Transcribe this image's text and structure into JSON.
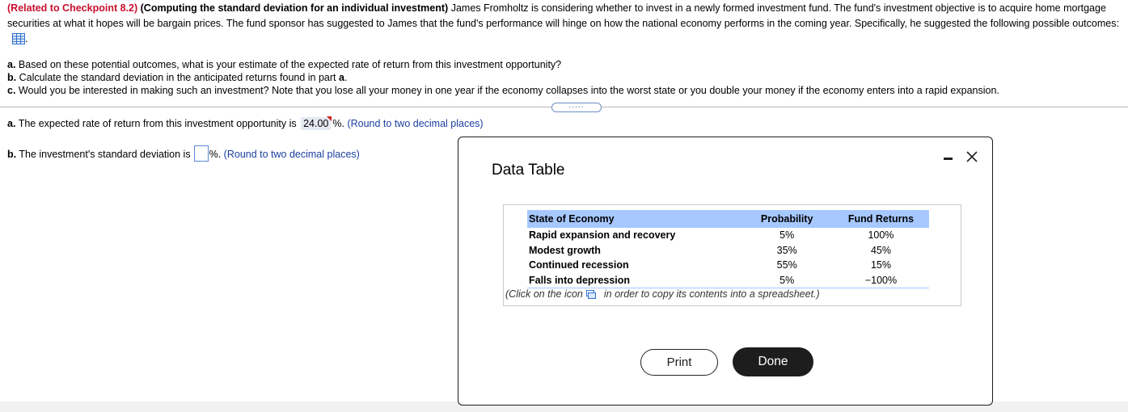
{
  "problem": {
    "tag": "(Related to Checkpoint 8.2)",
    "heading": "(Computing the standard deviation for an individual investment)",
    "body": "James Fromholtz is considering whether to invest in a newly formed investment fund. The fund's investment objective is to acquire home mortgage securities at what it hopes will be bargain prices. The fund sponsor has suggested to James that the fund's performance will hinge on how the national economy performs in the coming year. Specifically, he suggested the following possible outcomes:",
    "icon": "table-grid-icon",
    "after_icon": "."
  },
  "questions": {
    "a_letter": "a.",
    "a_text": "Based on these potential outcomes, what is your estimate of the expected rate of return from this investment opportunity?",
    "b_letter": "b.",
    "b_text": "Calculate the standard deviation in the anticipated returns found in part",
    "b_ref": "a",
    "b_end": ".",
    "c_letter": "c.",
    "c_text": "Would you be interested in making such an investment? Note that you lose all your money in one year if the economy collapses into the worst state or you double your money if the economy enters into a rapid expansion."
  },
  "more_dots": ".....",
  "answers": {
    "a_letter": "a.",
    "a_text": "The expected rate of return from this investment opportunity is",
    "a_value": "24.00",
    "a_unit": "%.",
    "a_hint": "(Round to two decimal places)",
    "b_letter": "b.",
    "b_text": "The investment's standard deviation is",
    "b_value": "",
    "b_unit": "%.",
    "b_hint": "(Round to two decimal places)"
  },
  "dialog": {
    "title": "Data Table",
    "columns": [
      "State of Economy",
      "Probability",
      "Fund Returns"
    ],
    "rows": [
      [
        "Rapid expansion and recovery",
        "5%",
        "100%"
      ],
      [
        "Modest growth",
        "35%",
        "45%"
      ],
      [
        "Continued recession",
        "55%",
        "15%"
      ],
      [
        "Falls into depression",
        "5%",
        "−100%"
      ]
    ],
    "note_pre": "(Click on the icon",
    "note_post": "in order to copy its contents into a spreadsheet.)",
    "print_label": "Print",
    "done_label": "Done"
  },
  "colors": {
    "accent": "#c8102e",
    "header": "#a6c8ff",
    "hint": "#1b3fa0",
    "done_bg": "#1d1d1d"
  }
}
